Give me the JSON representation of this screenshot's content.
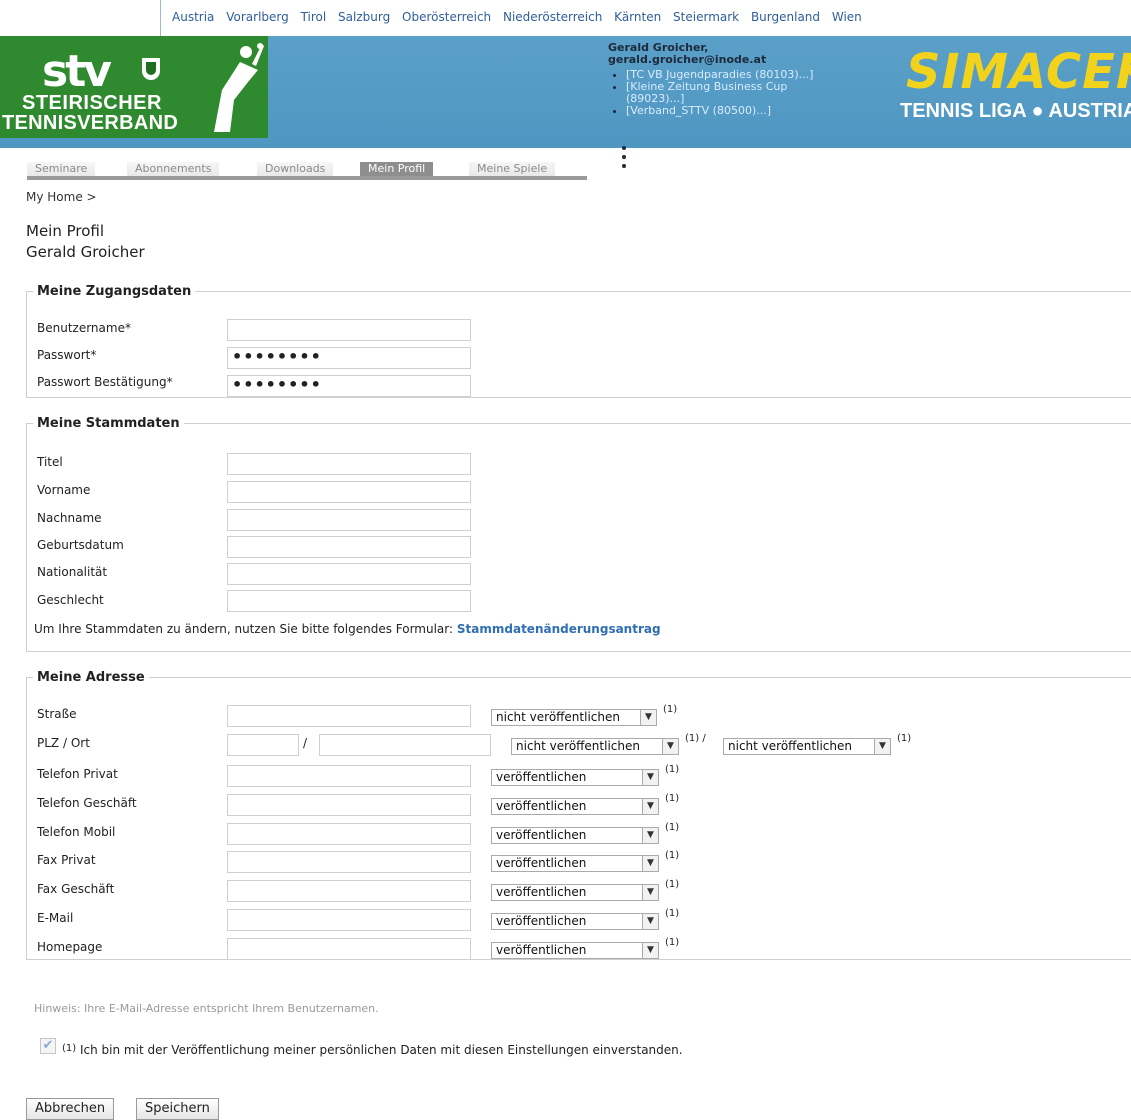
{
  "regions": [
    "Austria",
    "Vorarlberg",
    "Tirol",
    "Salzburg",
    "Oberösterreich",
    "Niederösterreich",
    "Kärnten",
    "Steiermark",
    "Burgenland",
    "Wien"
  ],
  "logo_left": {
    "big": "stv",
    "line1": "STEIRISCHER",
    "line2": "TENNISVERBAND"
  },
  "logo_right": {
    "big": "SIMACEK",
    "small": "TENNIS LIGA ● AUSTRIA"
  },
  "user": {
    "name": "Gerald Groicher,",
    "email": "gerald.groicher@inode.at",
    "clubs": [
      "[TC VB Jugendparadies (80103)...]",
      "[Kleine Zeitung Business Cup (89023)...]",
      "[Verband_STTV (80500)...]"
    ]
  },
  "tabs": [
    "Seminare",
    "Abonnements",
    "Downloads",
    "Mein Profil",
    "Meine Spiele"
  ],
  "active_tab": "Mein Profil",
  "breadcrumb": "My Home >",
  "page_title": "Mein Profil",
  "page_subtitle": "Gerald Groicher",
  "access": {
    "legend": "Meine Zugangsdaten",
    "username_label": "Benutzername*",
    "password_label": "Passwort*",
    "password_confirm_label": "Passwort Bestätigung*",
    "username_value": "",
    "password_value": "••••••••",
    "password_confirm_value": "••••••••"
  },
  "master": {
    "legend": "Meine Stammdaten",
    "fields": [
      "Titel",
      "Vorname",
      "Nachname",
      "Geburtsdatum",
      "Nationalität",
      "Geschlecht"
    ],
    "note": "Um Ihre Stammdaten zu ändern, nutzen Sie bitte folgendes Formular:",
    "note_link": "Stammdatenänderungsantrag"
  },
  "address": {
    "legend": "Meine Adresse",
    "street_label": "Straße",
    "zip_label": "PLZ / Ort",
    "slash": "/",
    "street_visibility": "nicht veröffentlichen",
    "zip_visibility": "nicht veröffentlichen",
    "city_visibility": "nicht veröffentlichen",
    "footnote": "(1)",
    "footnote_slash": "(1) /",
    "contact_labels": [
      "Telefon Privat",
      "Telefon Geschäft",
      "Telefon Mobil",
      "Fax Privat",
      "Fax Geschäft",
      "E-Mail",
      "Homepage"
    ],
    "contact_visibility": "veröffentlichen"
  },
  "hint": "Hinweis: Ihre E-Mail-Adresse entspricht Ihrem Benutzernamen.",
  "consent_sup": "(1)",
  "consent": "Ich bin mit der Veröffentlichung meiner persönlichen Daten mit diesen Einstellungen einverstanden.",
  "consent_checked": true,
  "buttons": {
    "cancel": "Abbrechen",
    "save": "Speichern"
  }
}
